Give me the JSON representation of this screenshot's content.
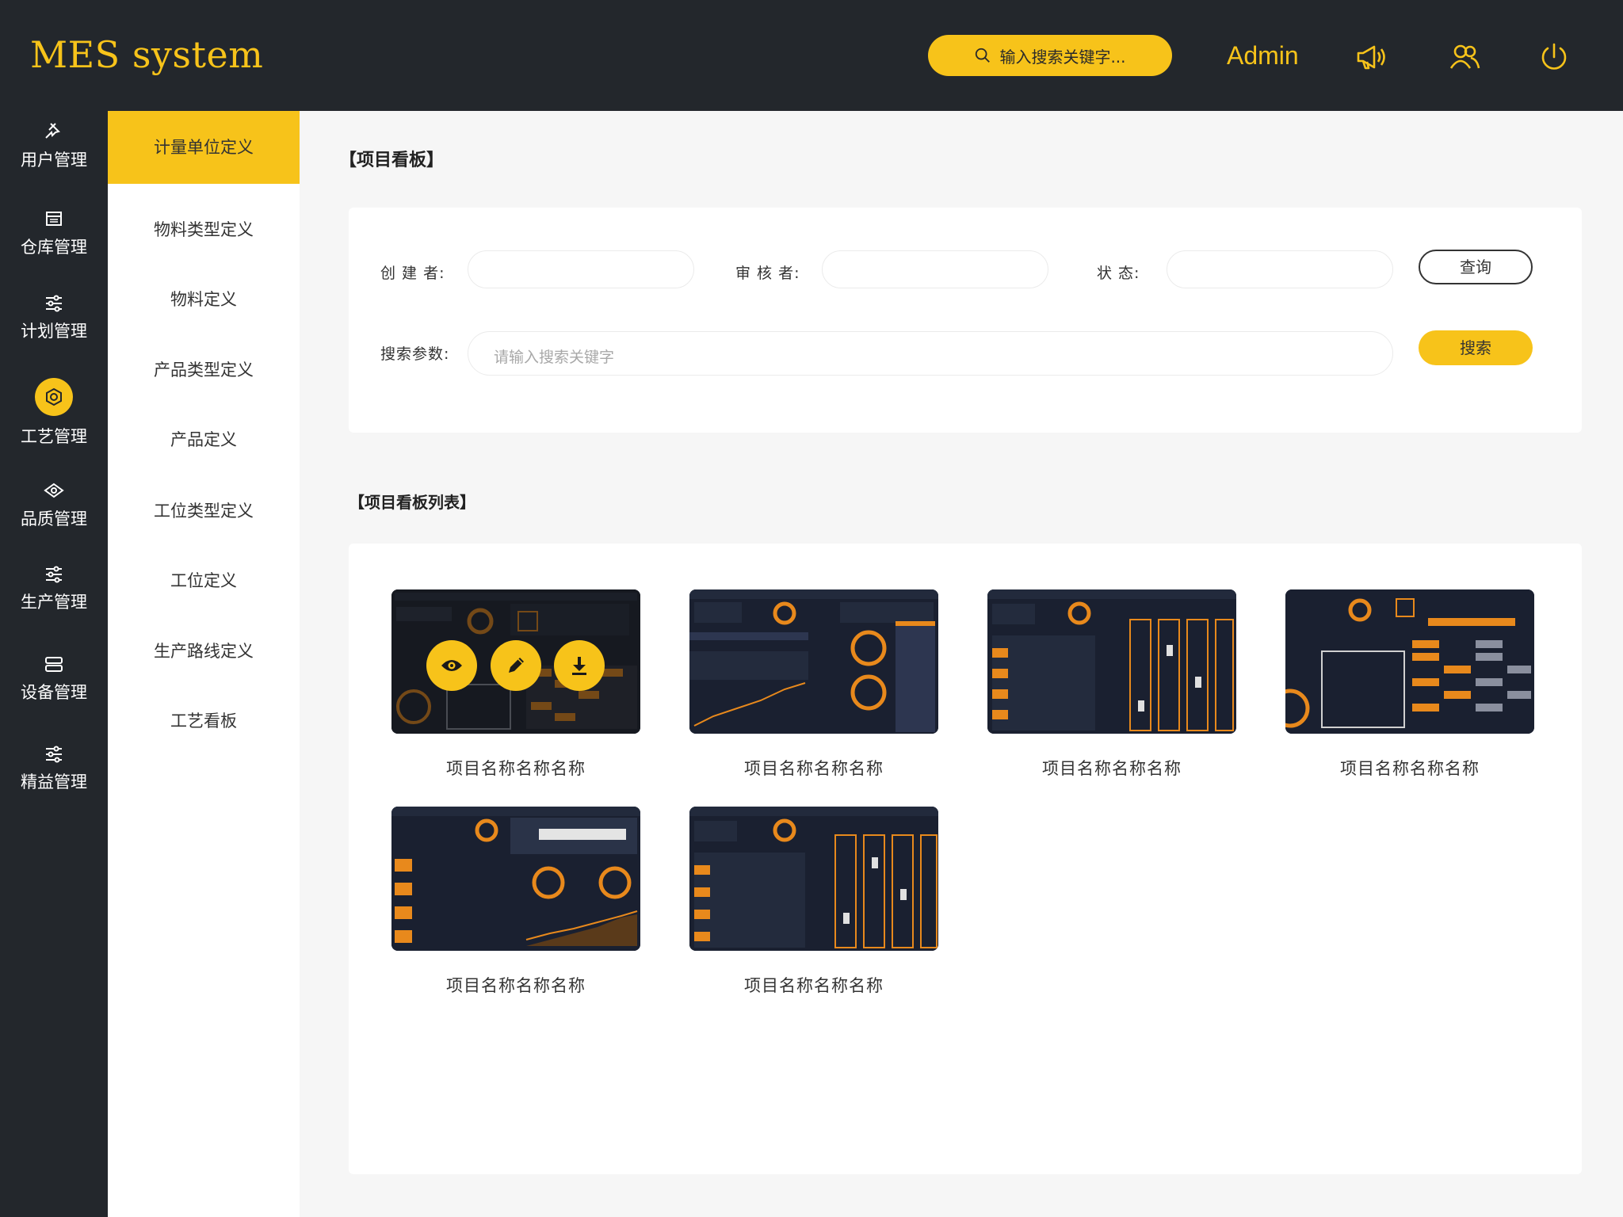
{
  "app": {
    "title": "MES system"
  },
  "header": {
    "search_placeholder": "输入搜索关键字...",
    "user": "Admin",
    "icons": [
      "search-icon",
      "megaphone-icon",
      "users-icon",
      "power-icon"
    ]
  },
  "sidebar": {
    "items": [
      {
        "label": "用户管理",
        "icon": "pin-icon"
      },
      {
        "label": "仓库管理",
        "icon": "warehouse-icon"
      },
      {
        "label": "计划管理",
        "icon": "sliders-icon"
      },
      {
        "label": "工艺管理",
        "icon": "process-icon",
        "active": true
      },
      {
        "label": "品质管理",
        "icon": "diamond-icon"
      },
      {
        "label": "生产管理",
        "icon": "sliders-icon"
      },
      {
        "label": "设备管理",
        "icon": "server-icon"
      },
      {
        "label": "精益管理",
        "icon": "sliders-icon"
      }
    ]
  },
  "submenu": {
    "items": [
      {
        "label": "计量单位定义",
        "active": true
      },
      {
        "label": "物料类型定义"
      },
      {
        "label": "物料定义"
      },
      {
        "label": "产品类型定义"
      },
      {
        "label": "产品定义"
      },
      {
        "label": "工位类型定义"
      },
      {
        "label": "工位定义"
      },
      {
        "label": "生产路线定义"
      },
      {
        "label": "工艺看板"
      }
    ]
  },
  "main": {
    "title": "【项目看板】",
    "filter": {
      "creator_label": "创 建 者:",
      "reviewer_label": "审 核 者:",
      "status_label": "状   态:",
      "query_button": "查询",
      "search_label": "搜索参数:",
      "search_placeholder": "请输入搜索关键字",
      "search_button": "搜索"
    },
    "list_title": "【项目看板列表】",
    "cards": [
      {
        "name": "项目名称名称名称",
        "hover": true
      },
      {
        "name": "项目名称名称名称"
      },
      {
        "name": "项目名称名称名称"
      },
      {
        "name": "项目名称名称名称"
      },
      {
        "name": "项目名称名称名称"
      },
      {
        "name": "项目名称名称名称"
      }
    ],
    "card_overlay_actions": [
      "view-icon",
      "edit-icon",
      "download-icon"
    ]
  },
  "colors": {
    "accent": "#f7c31a",
    "dark": "#23272c",
    "dashboard_bg": "#1a2030",
    "dashboard_accent": "#e8891c"
  }
}
